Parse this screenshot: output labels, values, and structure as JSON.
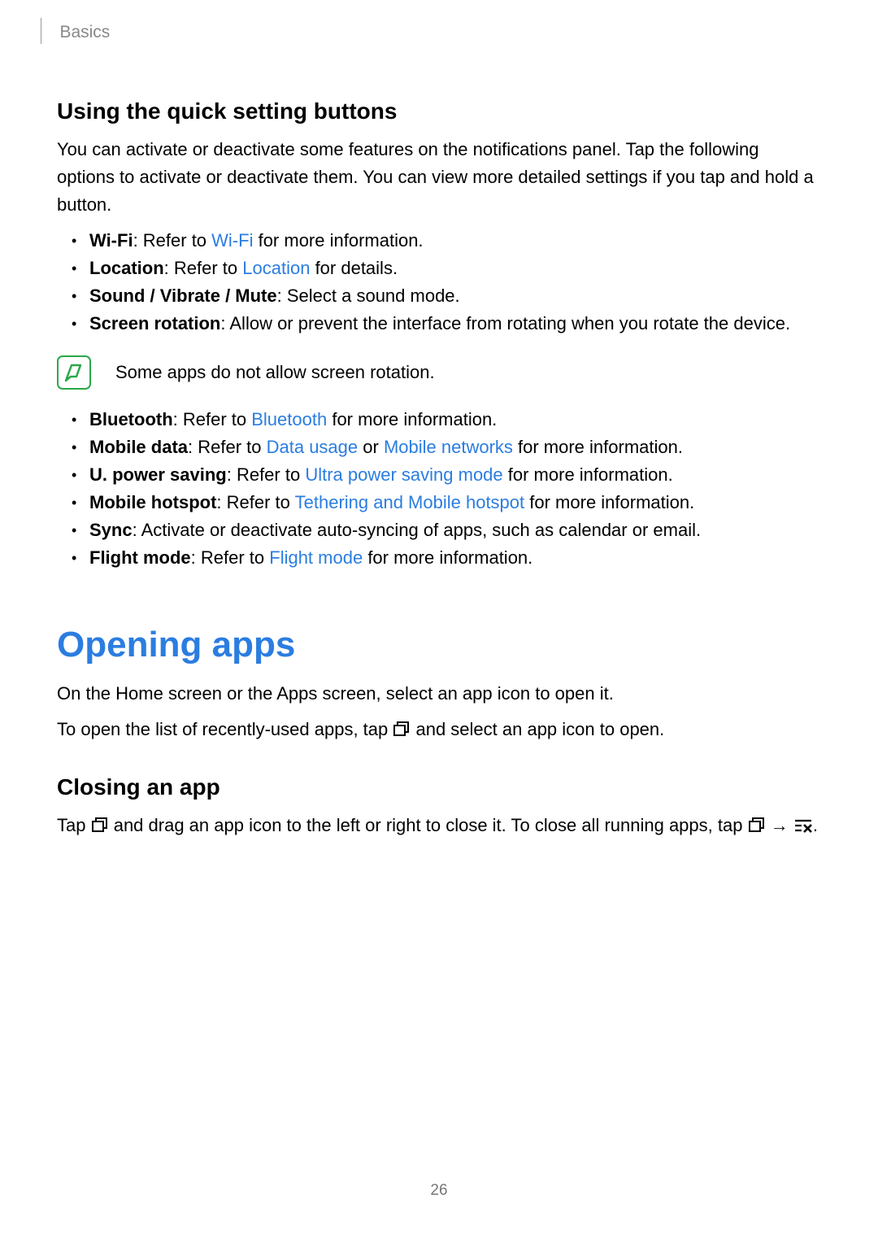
{
  "header": {
    "breadcrumb": "Basics"
  },
  "section1": {
    "heading": "Using the quick setting buttons",
    "intro": "You can activate or deactivate some features on the notifications panel. Tap the following options to activate or deactivate them. You can view more detailed settings if you tap and hold a button.",
    "list1": {
      "wifi": {
        "label": "Wi-Fi",
        "pre": ": Refer to ",
        "link": "Wi-Fi",
        "post": " for more information."
      },
      "location": {
        "label": "Location",
        "pre": ": Refer to ",
        "link": "Location",
        "post": " for details."
      },
      "sound": {
        "label": "Sound / Vibrate / Mute",
        "post": ": Select a sound mode."
      },
      "rotation": {
        "label": "Screen rotation",
        "post": ": Allow or prevent the interface from rotating when you rotate the device."
      }
    },
    "note": "Some apps do not allow screen rotation.",
    "list2": {
      "bluetooth": {
        "label": "Bluetooth",
        "pre": ": Refer to ",
        "link": "Bluetooth",
        "post": " for more information."
      },
      "mobiledata": {
        "label": "Mobile data",
        "pre": ": Refer to ",
        "link1": "Data usage",
        "mid": " or ",
        "link2": "Mobile networks",
        "post": " for more information."
      },
      "upower": {
        "label": "U. power saving",
        "pre": ": Refer to ",
        "link": "Ultra power saving mode",
        "post": " for more information."
      },
      "hotspot": {
        "label": "Mobile hotspot",
        "pre": ": Refer to ",
        "link": "Tethering and Mobile hotspot",
        "post": " for more information."
      },
      "sync": {
        "label": "Sync",
        "post": ": Activate or deactivate auto-syncing of apps, such as calendar or email."
      },
      "flight": {
        "label": "Flight mode",
        "pre": ": Refer to ",
        "link": "Flight mode",
        "post": " for more information."
      }
    }
  },
  "section2": {
    "title": "Opening apps",
    "p1": "On the Home screen or the Apps screen, select an app icon to open it.",
    "p2_a": "To open the list of recently-used apps, tap ",
    "p2_b": " and select an app icon to open.",
    "closing_heading": "Closing an app",
    "c_a": "Tap ",
    "c_b": " and drag an app icon to the left or right to close it. To close all running apps, tap ",
    "c_c": " → ",
    "c_d": "."
  },
  "page_number": "26"
}
